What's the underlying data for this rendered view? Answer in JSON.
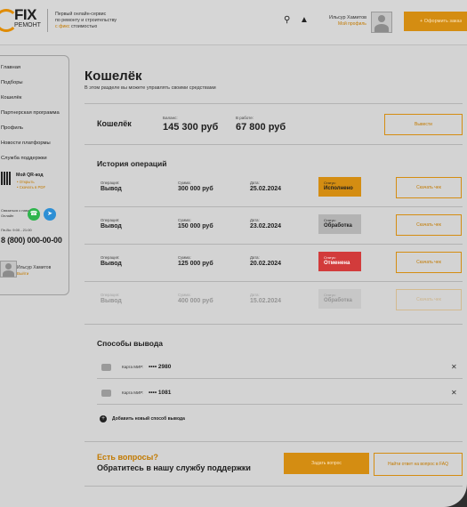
{
  "header": {
    "logo_name": "FIX",
    "logo_sub": "РЕМОНТ",
    "tagline_1": "Первый онлайн-сервис",
    "tagline_2": "по ремонту и строительству",
    "tagline_accent": "с фикс",
    "tagline_3": "стоимостью",
    "user_name": "Ильсур Хамитов",
    "user_role": "Мой профиль",
    "order_button": "+ Оформить заказ"
  },
  "sidebar": {
    "items": [
      "Главная",
      "Подборы",
      "Кошелёк",
      "Партнерская программа",
      "Профиль",
      "Новости платформы",
      "Служба поддержки"
    ],
    "qr_title": "Мой QR-код",
    "qr_link_1": "• Открыть",
    "qr_link_2": "• Скачать в PDF",
    "contact_1": "Связаться с нами:",
    "contact_2": "Онлайн",
    "hours": "Пн-Вс: 9:00 - 21:00",
    "phone": "8 (800) 000-00-00",
    "user_name": "Ильсур Хамитов",
    "user_role": "Выйти"
  },
  "main": {
    "title": "Кошелёк",
    "subtitle": "В этом разделе вы можете управлять своими средствами",
    "wallet": {
      "title": "Кошелёк",
      "balance_label": "Баланс:",
      "balance": "145 300 руб",
      "in_work_label": "В работе:",
      "in_work": "67 800 руб",
      "withdraw_button": "Вывести"
    },
    "history": {
      "title": "История операций",
      "operation_label": "Операция:",
      "sum_label": "Сумма:",
      "date_label": "Дата:",
      "status_label": "Статус:",
      "receipt_button": "Скачать чек",
      "rows": [
        {
          "operation": "Вывод",
          "sum": "300 000 руб",
          "date": "25.02.2024",
          "status": "Исполнено",
          "color": "#d48d12"
        },
        {
          "operation": "Вывод",
          "sum": "150 000 руб",
          "date": "23.02.2024",
          "status": "Обработка",
          "color": "#b3b3b3"
        },
        {
          "operation": "Вывод",
          "sum": "125 000 руб",
          "date": "20.02.2024",
          "status": "Отменена",
          "color": "#d23b3b"
        },
        {
          "operation": "Вывод",
          "sum": "400 000 руб",
          "date": "15.02.2024",
          "status": "Обработка",
          "color": "#b3b3b3"
        }
      ]
    },
    "methods": {
      "title": "Способы вывода",
      "cards": [
        {
          "label": "Карта МИР:",
          "number": "•••• 2980"
        },
        {
          "label": "Карта МИР:",
          "number": "•••• 1081"
        }
      ],
      "add_label": "Добавить новый способ вывода"
    },
    "support": {
      "title": "Есть вопросы?",
      "subtitle": "Обратитесь в нашу службу поддержки",
      "ask_button": "Задать вопрос",
      "faq_button": "Найти ответ на вопрос в FAQ"
    }
  },
  "colors": {
    "accent": "#d48d12",
    "cancel": "#d23b3b",
    "pending": "#b3b3b3"
  }
}
